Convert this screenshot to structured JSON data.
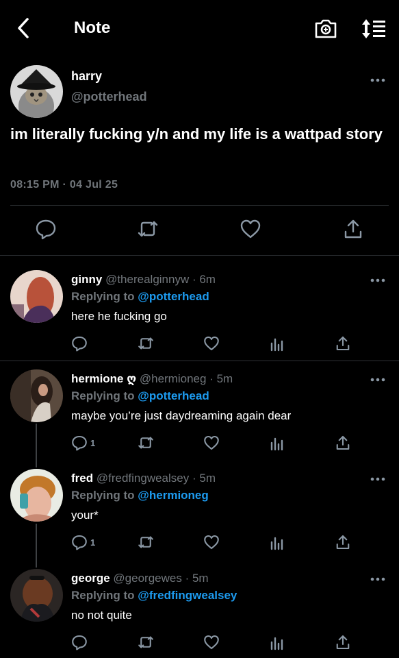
{
  "header": {
    "title": "Note",
    "back_icon": "chevron-left-icon",
    "camera_icon": "camera-icon",
    "sort_icon": "sort-lines-icon"
  },
  "main_post": {
    "name": "harry",
    "handle": "@potterhead",
    "text": "im literally fucking y/n and my life is a wattpad story",
    "timestamp": "08:15 PM · 04 Jul 25",
    "actions": [
      "reply-icon",
      "retweet-icon",
      "like-icon",
      "share-icon"
    ]
  },
  "replies": [
    {
      "name": "ginny",
      "badge": "",
      "handle": "@therealginnyw",
      "time": "· 6m",
      "replying_label": "Replying to",
      "replying_to": "@potterhead",
      "text": "here he fucking go",
      "reply_count": ""
    },
    {
      "name": "hermione",
      "badge": "ღ",
      "handle": "@hermioneg",
      "time": "· 5m",
      "replying_label": "Replying to",
      "replying_to": "@potterhead",
      "text": "maybe you’re just daydreaming again dear",
      "reply_count": "1"
    },
    {
      "name": "fred",
      "badge": "",
      "handle": "@fredfingwealsey",
      "time": "· 5m",
      "replying_label": "Replying to",
      "replying_to": "@hermioneg",
      "text": "your*",
      "reply_count": "1"
    },
    {
      "name": "george",
      "badge": "",
      "handle": "@georgewes",
      "time": "· 5m",
      "replying_label": "Replying to",
      "replying_to": "@fredfingwealsey",
      "text": "no not quite",
      "reply_count": ""
    }
  ],
  "colors": {
    "background": "#000000",
    "text": "#ffffff",
    "muted": "#71767b",
    "accent": "#1d9bf0",
    "divider": "#2f3336"
  }
}
